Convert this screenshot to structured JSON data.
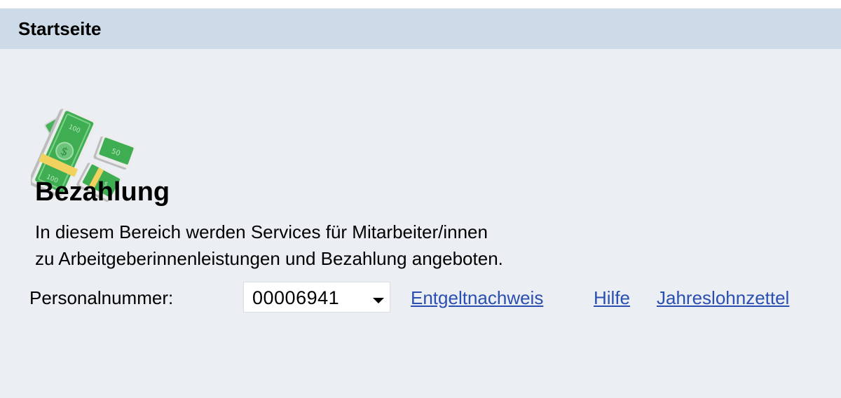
{
  "header": {
    "title": "Startseite"
  },
  "main": {
    "icon": "money-stack-icon",
    "title": "Bezahlung",
    "description_line1": "In diesem Bereich werden Services für Mitarbeiter/innen",
    "description_line2": "zu Arbeitgeberinnenleistungen und Bezahlung angeboten."
  },
  "personnel": {
    "label": "Personalnummer:",
    "selected_value": "00006941"
  },
  "links": {
    "pay_statement": "Entgeltnachweis",
    "help": "Hilfe",
    "annual_wage_slip": "Jahreslohnzettel"
  },
  "colors": {
    "header_bg": "#cddbe9",
    "content_bg": "#ebeef2",
    "link": "#2a4fb0",
    "money_green": "#3fae53"
  }
}
